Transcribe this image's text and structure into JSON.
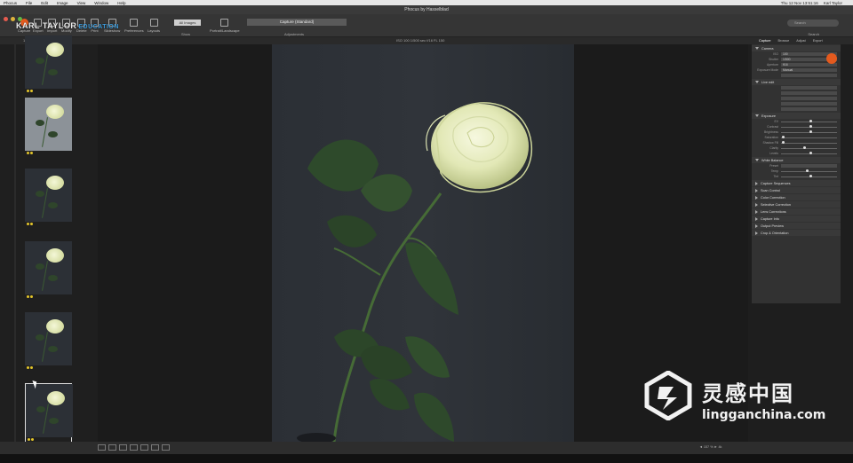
{
  "menubar": {
    "items": [
      "Phocus",
      "File",
      "Edit",
      "Image",
      "View",
      "Window",
      "Help"
    ],
    "status": [
      "Thu 12 Nov 13:51:16",
      "Karl Taylor"
    ]
  },
  "window": {
    "title": "Phocus by Hasselblad"
  },
  "brand": {
    "name": "KARL TAYLOR",
    "suffix": "EDUCATION"
  },
  "toolbar": {
    "items": [
      "Capture",
      "Export",
      "Import",
      "Modify",
      "Delete",
      "Print",
      "Slideshow",
      "Preferences",
      "Layouts"
    ],
    "show_value": "All Images",
    "show_label": "Show",
    "orientation_label": "Portrait/Landscape",
    "workspace_value": "Capture (Standard)",
    "workspace_label": "Adjustments",
    "search_placeholder": "Search",
    "search_label": "Search"
  },
  "subbar": {
    "count": "1 of 56 images",
    "meta": "ISO 100   1/500 sec   f/16   FL 150"
  },
  "inspector": {
    "tabs": [
      "Capture",
      "Browse",
      "Adjust",
      "Export"
    ],
    "panels": {
      "camera": "Camera",
      "live_edit": "Live edit",
      "exposure": "Exposure",
      "white_balance": "White Balance",
      "collapsed": [
        "Capture Sequences",
        "Scan Control",
        "Color Correction",
        "Selective Correction",
        "Lens Corrections",
        "Capture Info",
        "Output Preview",
        "Crop & Orientation"
      ]
    },
    "camera_rows": [
      {
        "k": "ISO",
        "v": "100"
      },
      {
        "k": "Shutter",
        "v": "1/500"
      },
      {
        "k": "Aperture",
        "v": "f/16"
      },
      {
        "k": "Exposure Mode",
        "v": "Manual"
      }
    ],
    "exposure_rows": [
      "EV",
      "Contrast",
      "Brightness",
      "Saturation",
      "Shadow Fill",
      "Clarity",
      "Levels"
    ],
    "wb_rows": [
      "Preset",
      "Temp",
      "Tint"
    ]
  },
  "thumbnails": [
    {
      "label": "",
      "stars": 2
    },
    {
      "label": "",
      "stars": 2
    },
    {
      "label": "",
      "stars": 2
    },
    {
      "label": "",
      "stars": 2
    },
    {
      "label": "",
      "stars": 2
    },
    {
      "label": "",
      "stars": 2
    }
  ],
  "bottom": {
    "zoom": "◄ 157 % ► 4k"
  },
  "watermark": {
    "cn": "灵感中国",
    "en": "lingganchina.com"
  },
  "colors": {
    "accent": "#e45a1e",
    "brand_blue": "#3f9fe0",
    "bg": "#1e1e1e"
  }
}
